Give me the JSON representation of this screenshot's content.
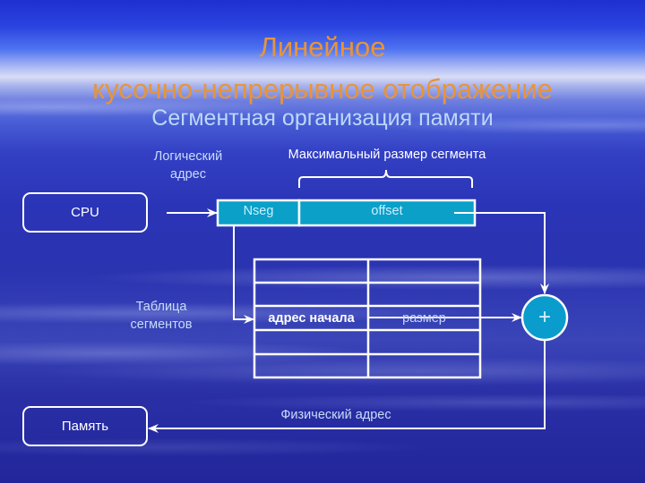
{
  "slide": {
    "title_line1": "Линейное",
    "title_line2": "кусочно-непрерывное отображение",
    "subtitle": "Сегментная организация памяти"
  },
  "colors": {
    "title": "#e8943a",
    "subtitle": "#bcd8f8",
    "segment_fill": "#0aa0c8",
    "adder_fill": "#0a9ccc",
    "lines": "#ffffff"
  },
  "diagram": {
    "cpu_label": "CPU",
    "memory_label": "Память",
    "logical_address_label": "Логический адрес",
    "logical_address_line1": "Логический",
    "logical_address_line2": "адрес",
    "max_segment_size_label": "Максимальный размер сегмента",
    "address_fields": {
      "nseg": "Nseg",
      "offset": "offset"
    },
    "segment_table_label_line1": "Таблица",
    "segment_table_label_line2": "сегментов",
    "segment_table": {
      "rows": 5,
      "columns": 2,
      "highlighted_row_index": 2,
      "highlighted_row": {
        "start_address": "адрес начала",
        "size": "размер"
      }
    },
    "adder_symbol": "+",
    "physical_address_label": "Физический адрес"
  }
}
